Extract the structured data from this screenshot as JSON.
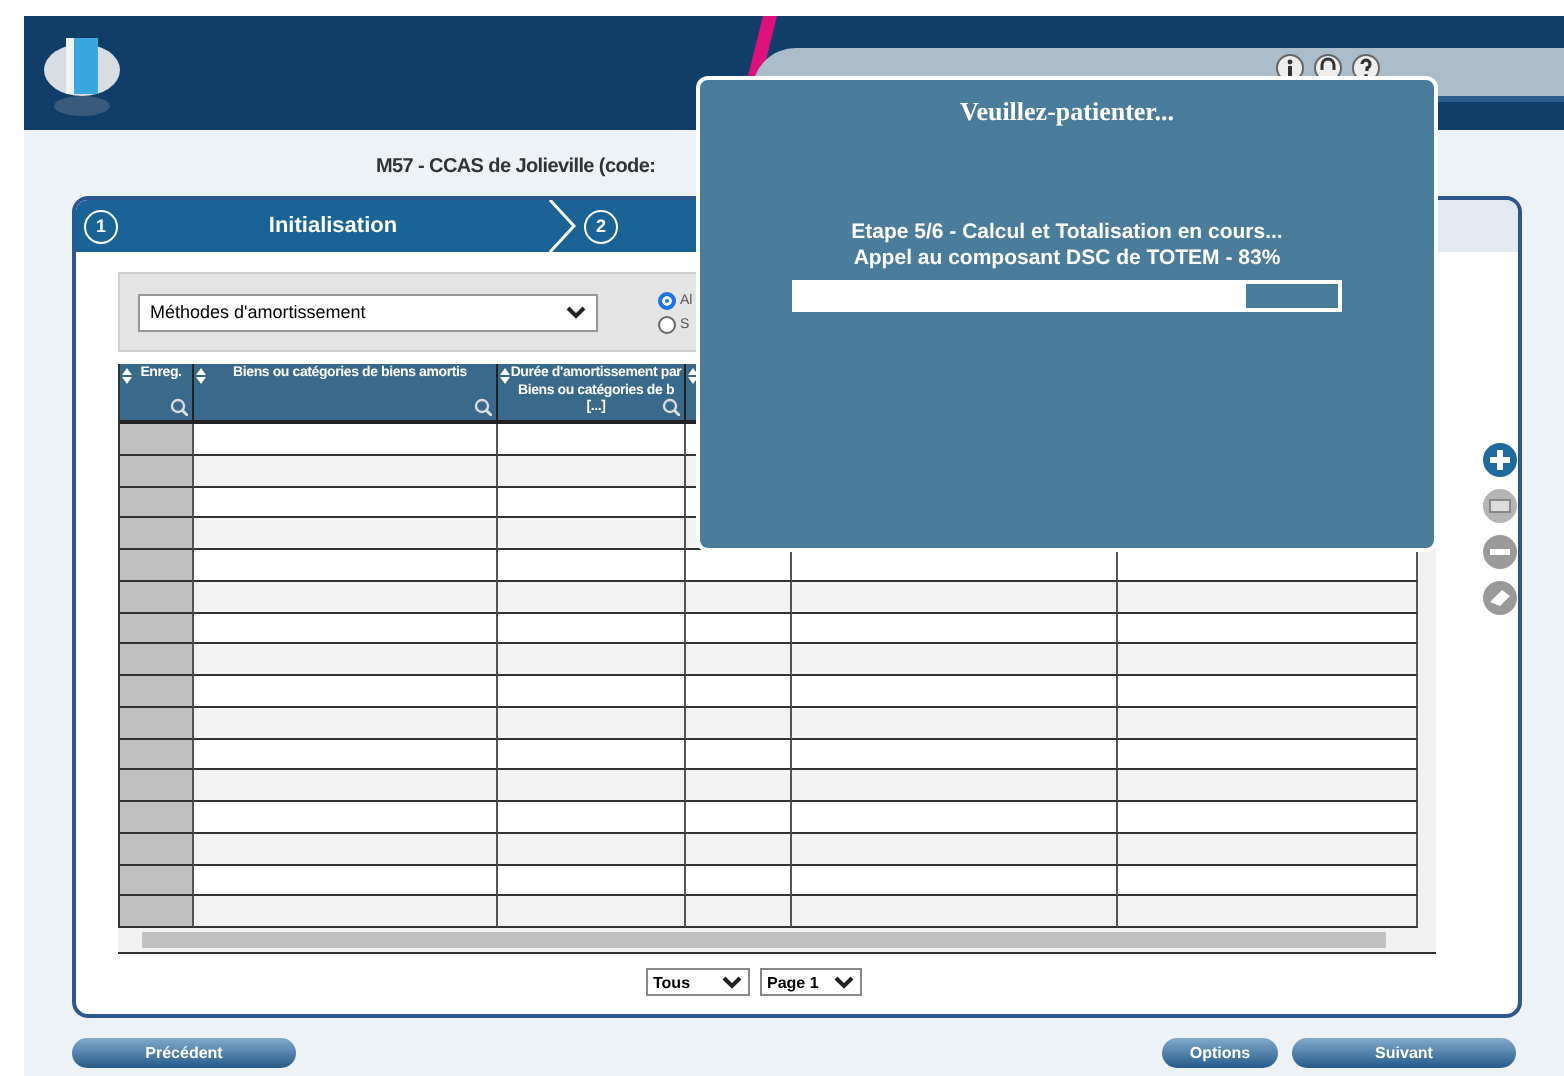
{
  "title": "M57 - CCAS de Jolieville (code:",
  "steps": [
    {
      "number": "1",
      "label": "Initialisation",
      "selected": true
    },
    {
      "number": "2",
      "selected": false
    }
  ],
  "filter": {
    "select": "Méthodes d'amortissement",
    "radios": [
      {
        "label": "Al",
        "selected": true
      },
      {
        "label": "S",
        "selected": false
      }
    ]
  },
  "table": {
    "columns": [
      "Enreg.",
      "Biens ou catégories de biens amortis",
      "Durée d'amortissement par Biens ou catégories de b [...]"
    ]
  },
  "pager": {
    "size": "Tous",
    "page": "Page 1"
  },
  "buttons": {
    "left": [
      "Précédent"
    ],
    "right": [
      "Options",
      "Suivant"
    ]
  },
  "modal": {
    "title": "Veuillez-patienter...",
    "lines": [
      "Etape 5/6 - Calcul et Totalisation en cours...",
      "Appel au composant DSC de TOTEM - 83%"
    ],
    "progress": {
      "level": 0.83
    }
  }
}
